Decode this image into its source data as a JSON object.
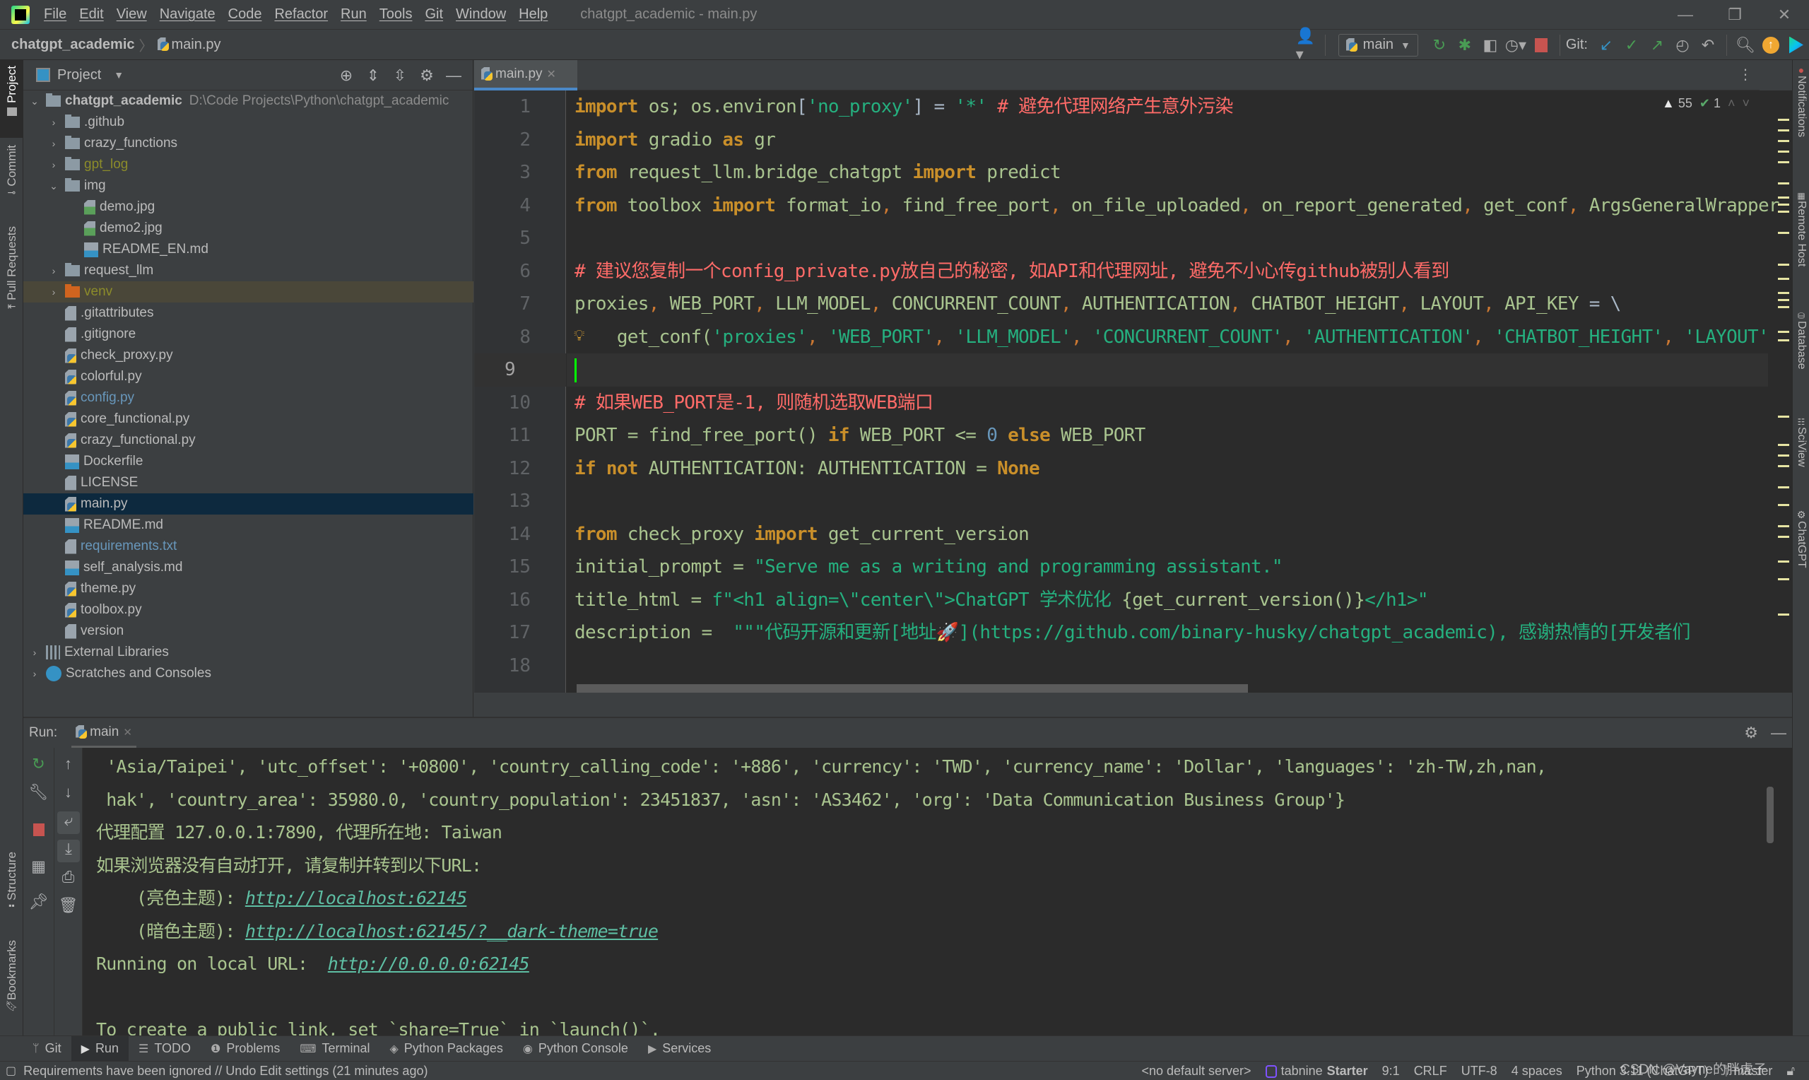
{
  "window": {
    "title": "chatgpt_academic - main.py",
    "controls": {
      "minimize": "—",
      "restore": "❐",
      "close": "✕"
    }
  },
  "menu": [
    "File",
    "Edit",
    "View",
    "Navigate",
    "Code",
    "Refactor",
    "Run",
    "Tools",
    "Git",
    "Window",
    "Help"
  ],
  "navbar": {
    "project": "chatgpt_academic",
    "separator": "〉",
    "file": "main.py",
    "run_config": "main",
    "git_label": "Git:",
    "icons": [
      "user-icon",
      "rerun-icon",
      "debug-icon",
      "coverage-icon",
      "profile-icon",
      "stop-icon",
      "git-update-icon",
      "git-commit-icon",
      "git-push-icon",
      "history-icon",
      "rollback-icon",
      "search-icon",
      "update-icon",
      "jetbrains-ai-icon"
    ]
  },
  "left_strip": {
    "tabs": [
      "Project",
      "Commit",
      "Pull Requests",
      "Structure",
      "Bookmarks"
    ]
  },
  "right_strip": {
    "tabs": [
      "Notifications",
      "Remote Host",
      "Database",
      "SciView",
      "ChatGPT"
    ]
  },
  "project": {
    "title": "Project",
    "root_name": "chatgpt_academic",
    "root_path": "D:\\Code Projects\\Python\\chatgpt_academic",
    "items": [
      {
        "name": ".github",
        "type": "folder",
        "depth": 1,
        "expanded": false
      },
      {
        "name": "crazy_functions",
        "type": "folder",
        "depth": 1,
        "expanded": false
      },
      {
        "name": "gpt_log",
        "type": "folder",
        "depth": 1,
        "expanded": false,
        "color": "olive"
      },
      {
        "name": "img",
        "type": "folder",
        "depth": 1,
        "expanded": true
      },
      {
        "name": "demo.jpg",
        "type": "img",
        "depth": 2
      },
      {
        "name": "demo2.jpg",
        "type": "img",
        "depth": 2
      },
      {
        "name": "README_EN.md",
        "type": "md",
        "depth": 2
      },
      {
        "name": "request_llm",
        "type": "folder",
        "depth": 1,
        "expanded": false
      },
      {
        "name": "venv",
        "type": "folder-excluded",
        "depth": 1,
        "expanded": false,
        "color": "olive"
      },
      {
        "name": ".gitattributes",
        "type": "text",
        "depth": 1
      },
      {
        "name": ".gitignore",
        "type": "text",
        "depth": 1
      },
      {
        "name": "check_proxy.py",
        "type": "py",
        "depth": 1
      },
      {
        "name": "colorful.py",
        "type": "py",
        "depth": 1
      },
      {
        "name": "config.py",
        "type": "py",
        "depth": 1,
        "color": "blue"
      },
      {
        "name": "core_functional.py",
        "type": "py",
        "depth": 1
      },
      {
        "name": "crazy_functional.py",
        "type": "py",
        "depth": 1
      },
      {
        "name": "Dockerfile",
        "type": "docker",
        "depth": 1
      },
      {
        "name": "LICENSE",
        "type": "text",
        "depth": 1
      },
      {
        "name": "main.py",
        "type": "py",
        "depth": 1,
        "selected": true
      },
      {
        "name": "README.md",
        "type": "md",
        "depth": 1
      },
      {
        "name": "requirements.txt",
        "type": "text",
        "depth": 1,
        "color": "blue"
      },
      {
        "name": "self_analysis.md",
        "type": "md",
        "depth": 1
      },
      {
        "name": "theme.py",
        "type": "py",
        "depth": 1
      },
      {
        "name": "toolbox.py",
        "type": "py",
        "depth": 1
      },
      {
        "name": "version",
        "type": "text",
        "depth": 1
      }
    ],
    "extra": [
      "External Libraries",
      "Scratches and Consoles"
    ]
  },
  "editor": {
    "tab": "main.py",
    "inspections": {
      "warnings": "55",
      "weak_warnings": "1"
    },
    "current_line": 9,
    "lines": [
      [
        [
          "kw2",
          "import"
        ],
        [
          "ident",
          " os; os.environ"
        ],
        [
          "",
          "["
        ],
        [
          "strg",
          "'no_proxy'"
        ],
        [
          "",
          "] "
        ],
        [
          "",
          "= "
        ],
        [
          "strg",
          "'*'"
        ],
        [
          "",
          " "
        ],
        [
          "cmt",
          "# 避免代理网络产生意外污染"
        ]
      ],
      [
        [
          "kw2",
          "import"
        ],
        [
          "ident",
          " gradio "
        ],
        [
          "kw2",
          "as"
        ],
        [
          "ident",
          " gr"
        ]
      ],
      [
        [
          "kw2",
          "from"
        ],
        [
          "ident",
          " request_llm.bridge_chatgpt "
        ],
        [
          "kw2",
          "import"
        ],
        [
          "ident",
          " predict"
        ]
      ],
      [
        [
          "kw2",
          "from"
        ],
        [
          "ident",
          " toolbox "
        ],
        [
          "kw2",
          "import"
        ],
        [
          "ident",
          " format_io"
        ],
        [
          "cm",
          ", "
        ],
        [
          "ident",
          "find_free_port"
        ],
        [
          "cm",
          ", "
        ],
        [
          "ident",
          "on_file_uploaded"
        ],
        [
          "cm",
          ", "
        ],
        [
          "ident",
          "on_report_generated"
        ],
        [
          "cm",
          ", "
        ],
        [
          "ident",
          "get_conf"
        ],
        [
          "cm",
          ", "
        ],
        [
          "ident",
          "ArgsGeneralWrapper"
        ]
      ],
      [],
      [
        [
          "cmt",
          "# 建议您复制一个config_private.py放自己的秘密, 如API和代理网址, 避免不小心传github被别人看到"
        ]
      ],
      [
        [
          "ident",
          "proxies"
        ],
        [
          "cm",
          ", "
        ],
        [
          "ident",
          "WEB_PORT"
        ],
        [
          "cm",
          ", "
        ],
        [
          "ident",
          "LLM_MODEL"
        ],
        [
          "cm",
          ", "
        ],
        [
          "ident",
          "CONCURRENT_COUNT"
        ],
        [
          "cm",
          ", "
        ],
        [
          "ident",
          "AUTHENTICATION"
        ],
        [
          "cm",
          ", "
        ],
        [
          "ident",
          "CHATBOT_HEIGHT"
        ],
        [
          "cm",
          ", "
        ],
        [
          "ident",
          "LAYOUT"
        ],
        [
          "cm",
          ", "
        ],
        [
          "ident",
          "API_KEY"
        ],
        [
          "",
          " = \\"
        ]
      ],
      [
        [
          "ident",
          "    get_conf("
        ],
        [
          "strg",
          "'proxies'"
        ],
        [
          "cm",
          ", "
        ],
        [
          "strg",
          "'WEB_PORT'"
        ],
        [
          "cm",
          ", "
        ],
        [
          "strg",
          "'LLM_MODEL'"
        ],
        [
          "cm",
          ", "
        ],
        [
          "strg",
          "'CONCURRENT_COUNT'"
        ],
        [
          "cm",
          ", "
        ],
        [
          "strg",
          "'AUTHENTICATION'"
        ],
        [
          "cm",
          ", "
        ],
        [
          "strg",
          "'CHATBOT_HEIGHT'"
        ],
        [
          "cm",
          ", "
        ],
        [
          "strg",
          "'LAYOUT'"
        ]
      ],
      [],
      [
        [
          "cmt",
          "# 如果WEB_PORT是-1, 则随机选取WEB端口"
        ]
      ],
      [
        [
          "ident",
          "PORT = find_free_port() "
        ],
        [
          "kw2",
          "if"
        ],
        [
          "ident",
          " WEB_PORT <= "
        ],
        [
          "num",
          "0"
        ],
        [
          "",
          " "
        ],
        [
          "kw2",
          "else"
        ],
        [
          "ident",
          " WEB_PORT"
        ]
      ],
      [
        [
          "kw2",
          "if not"
        ],
        [
          "ident",
          " AUTHENTICATION: AUTHENTICATION = "
        ],
        [
          "kw2",
          "None"
        ]
      ],
      [],
      [
        [
          "kw2",
          "from"
        ],
        [
          "ident",
          " check_proxy "
        ],
        [
          "kw2",
          "import"
        ],
        [
          "ident",
          " get_current_version"
        ]
      ],
      [
        [
          "ident",
          "initial_prompt = "
        ],
        [
          "strg",
          "\"Serve me as a writing and programming assistant.\""
        ]
      ],
      [
        [
          "ident",
          "title_html = "
        ],
        [
          "strg",
          "f\"<h1 align=\\\"center\\\">ChatGPT 学术优化 "
        ],
        [
          "ident",
          "{get_current_version()}"
        ],
        [
          "strg",
          "</h1>\""
        ]
      ],
      [
        [
          "ident",
          "description = "
        ],
        [
          "strg",
          " \"\"\"代码开源和更新[地址🚀](https://github.com/binary-husky/chatgpt_academic), 感谢热情的[开发者们"
        ]
      ],
      []
    ]
  },
  "run": {
    "label": "Run:",
    "tab": "main",
    "console": [
      [
        [
          "",
          " 'Asia/Taipei', 'utc_offset': '+0800', 'country_calling_code': '+886', 'currency': 'TWD', 'currency_name': 'Dollar', 'languages': 'zh-TW,zh,nan,"
        ]
      ],
      [
        [
          "",
          " hak', 'country_area': 35980.0, 'country_population': 23451837, 'asn': 'AS3462', 'org': 'Data Communication Business Group'}"
        ]
      ],
      [
        [
          "",
          "代理配置 127.0.0.1:7890, 代理所在地: Taiwan"
        ]
      ],
      [
        [
          "",
          "如果浏览器没有自动打开, 请复制并转到以下URL:"
        ]
      ],
      [
        [
          "",
          "    (亮色主题): "
        ],
        [
          "link",
          "http://localhost:62145"
        ]
      ],
      [
        [
          "",
          "    (暗色主题): "
        ],
        [
          "link",
          "http://localhost:62145/?__dark-theme=true"
        ]
      ],
      [
        [
          "",
          "Running on local URL:  "
        ],
        [
          "link",
          "http://0.0.0.0:62145"
        ]
      ],
      [],
      [
        [
          "",
          "To create a public link, set `share=True` in `launch()`."
        ]
      ]
    ]
  },
  "toolwindows": [
    {
      "label": "Git",
      "icon": "git-branch-icon",
      "glyph": "ᛘ"
    },
    {
      "label": "Run",
      "icon": "run-icon",
      "glyph": "▶",
      "active": true
    },
    {
      "label": "TODO",
      "icon": "todo-icon",
      "glyph": "☰"
    },
    {
      "label": "Problems",
      "icon": "problems-icon",
      "glyph": "❶"
    },
    {
      "label": "Terminal",
      "icon": "terminal-icon",
      "glyph": "⌨"
    },
    {
      "label": "Python Packages",
      "icon": "packages-icon",
      "glyph": "◈"
    },
    {
      "label": "Python Console",
      "icon": "python-console-icon",
      "glyph": "◉"
    },
    {
      "label": "Services",
      "icon": "services-icon",
      "glyph": "▶"
    }
  ],
  "status": {
    "message": "Requirements have been ignored // Undo   Edit settings (21 minutes ago)",
    "server": "<no default server>",
    "tabnine": "tabnine",
    "tabnine_plan": "Starter",
    "position": "9:1",
    "line_sep": "CRLF",
    "encoding": "UTF-8",
    "indent": "4 spaces",
    "interpreter": "Python 3.11 (ChatGPT)",
    "branch": "master",
    "watermark": "CSDN @Vayne的胖虎子"
  }
}
